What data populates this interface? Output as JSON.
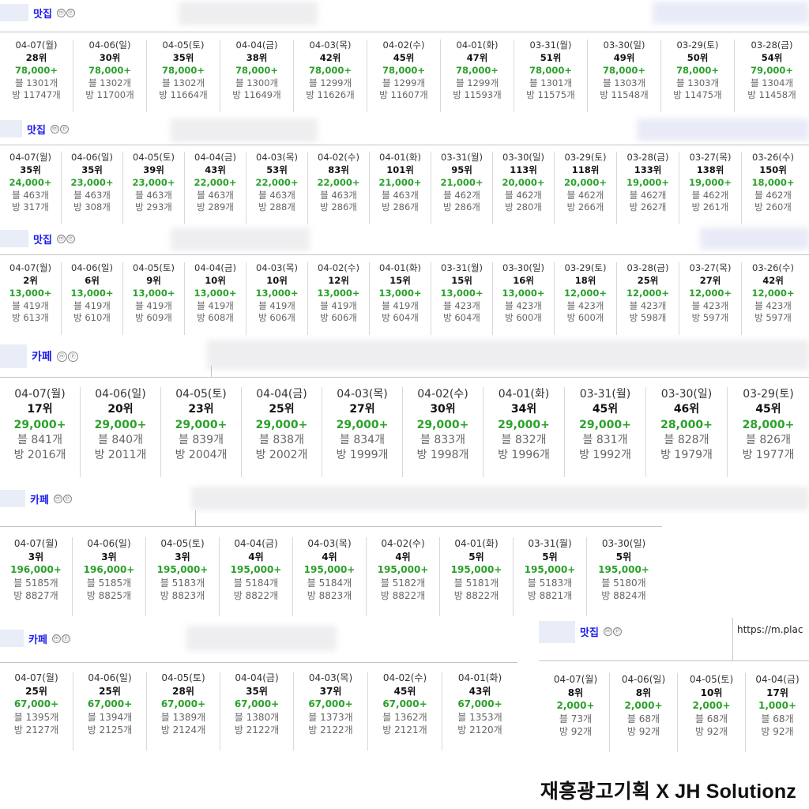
{
  "icon_labels": [
    "ⓜ",
    "ⓟ"
  ],
  "panels": [
    {
      "category": "맛집",
      "cells": [
        {
          "date": "04-07(월)",
          "rank": "28위",
          "price": "78,000+",
          "blog": "블 1301개",
          "bang": "방 11747개"
        },
        {
          "date": "04-06(일)",
          "rank": "30위",
          "price": "78,000+",
          "blog": "블 1302개",
          "bang": "방 11700개"
        },
        {
          "date": "04-05(토)",
          "rank": "35위",
          "price": "78,000+",
          "blog": "블 1302개",
          "bang": "방 11664개"
        },
        {
          "date": "04-04(금)",
          "rank": "38위",
          "price": "78,000+",
          "blog": "블 1300개",
          "bang": "방 11649개"
        },
        {
          "date": "04-03(목)",
          "rank": "42위",
          "price": "78,000+",
          "blog": "블 1299개",
          "bang": "방 11626개"
        },
        {
          "date": "04-02(수)",
          "rank": "45위",
          "price": "78,000+",
          "blog": "블 1299개",
          "bang": "방 11607개"
        },
        {
          "date": "04-01(화)",
          "rank": "47위",
          "price": "78,000+",
          "blog": "블 1299개",
          "bang": "방 11593개"
        },
        {
          "date": "03-31(월)",
          "rank": "51위",
          "price": "78,000+",
          "blog": "블 1301개",
          "bang": "방 11575개"
        },
        {
          "date": "03-30(일)",
          "rank": "49위",
          "price": "78,000+",
          "blog": "블 1303개",
          "bang": "방 11548개"
        },
        {
          "date": "03-29(토)",
          "rank": "50위",
          "price": "78,000+",
          "blog": "블 1303개",
          "bang": "방 11475개"
        },
        {
          "date": "03-28(금)",
          "rank": "54위",
          "price": "79,000+",
          "blog": "블 1304개",
          "bang": "방 11458개"
        }
      ]
    },
    {
      "category": "맛집",
      "cells": [
        {
          "date": "04-07(월)",
          "rank": "35위",
          "price": "24,000+",
          "blog": "블 463개",
          "bang": "방 317개"
        },
        {
          "date": "04-06(일)",
          "rank": "35위",
          "price": "23,000+",
          "blog": "블 463개",
          "bang": "방 308개"
        },
        {
          "date": "04-05(토)",
          "rank": "39위",
          "price": "23,000+",
          "blog": "블 463개",
          "bang": "방 293개"
        },
        {
          "date": "04-04(금)",
          "rank": "43위",
          "price": "22,000+",
          "blog": "블 463개",
          "bang": "방 289개"
        },
        {
          "date": "04-03(목)",
          "rank": "53위",
          "price": "22,000+",
          "blog": "블 463개",
          "bang": "방 288개"
        },
        {
          "date": "04-02(수)",
          "rank": "83위",
          "price": "22,000+",
          "blog": "블 463개",
          "bang": "방 286개"
        },
        {
          "date": "04-01(화)",
          "rank": "101위",
          "price": "21,000+",
          "blog": "블 463개",
          "bang": "방 286개"
        },
        {
          "date": "03-31(월)",
          "rank": "95위",
          "price": "21,000+",
          "blog": "블 462개",
          "bang": "방 286개"
        },
        {
          "date": "03-30(일)",
          "rank": "113위",
          "price": "20,000+",
          "blog": "블 462개",
          "bang": "방 280개"
        },
        {
          "date": "03-29(토)",
          "rank": "118위",
          "price": "20,000+",
          "blog": "블 462개",
          "bang": "방 266개"
        },
        {
          "date": "03-28(금)",
          "rank": "133위",
          "price": "19,000+",
          "blog": "블 462개",
          "bang": "방 262개"
        },
        {
          "date": "03-27(목)",
          "rank": "138위",
          "price": "19,000+",
          "blog": "블 462개",
          "bang": "방 261개"
        },
        {
          "date": "03-26(수)",
          "rank": "150위",
          "price": "18,000+",
          "blog": "블 462개",
          "bang": "방 260개"
        }
      ]
    },
    {
      "category": "맛집",
      "cells": [
        {
          "date": "04-07(월)",
          "rank": "2위",
          "price": "13,000+",
          "blog": "블 419개",
          "bang": "방 613개"
        },
        {
          "date": "04-06(일)",
          "rank": "6위",
          "price": "13,000+",
          "blog": "블 419개",
          "bang": "방 610개"
        },
        {
          "date": "04-05(토)",
          "rank": "9위",
          "price": "13,000+",
          "blog": "블 419개",
          "bang": "방 609개"
        },
        {
          "date": "04-04(금)",
          "rank": "10위",
          "price": "13,000+",
          "blog": "블 419개",
          "bang": "방 608개"
        },
        {
          "date": "04-03(목)",
          "rank": "10위",
          "price": "13,000+",
          "blog": "블 419개",
          "bang": "방 606개"
        },
        {
          "date": "04-02(수)",
          "rank": "12위",
          "price": "13,000+",
          "blog": "블 419개",
          "bang": "방 606개"
        },
        {
          "date": "04-01(화)",
          "rank": "15위",
          "price": "13,000+",
          "blog": "블 419개",
          "bang": "방 604개"
        },
        {
          "date": "03-31(월)",
          "rank": "15위",
          "price": "13,000+",
          "blog": "블 423개",
          "bang": "방 604개"
        },
        {
          "date": "03-30(일)",
          "rank": "16위",
          "price": "13,000+",
          "blog": "블 423개",
          "bang": "방 600개"
        },
        {
          "date": "03-29(토)",
          "rank": "18위",
          "price": "12,000+",
          "blog": "블 423개",
          "bang": "방 600개"
        },
        {
          "date": "03-28(금)",
          "rank": "25위",
          "price": "12,000+",
          "blog": "블 423개",
          "bang": "방 598개"
        },
        {
          "date": "03-27(목)",
          "rank": "27위",
          "price": "12,000+",
          "blog": "블 423개",
          "bang": "방 597개"
        },
        {
          "date": "03-26(수)",
          "rank": "42위",
          "price": "12,000+",
          "blog": "블 423개",
          "bang": "방 597개"
        }
      ]
    },
    {
      "category": "카페",
      "cells": [
        {
          "date": "04-07(월)",
          "rank": "17위",
          "price": "29,000+",
          "blog": "블 841개",
          "bang": "방 2016개"
        },
        {
          "date": "04-06(일)",
          "rank": "20위",
          "price": "29,000+",
          "blog": "블 840개",
          "bang": "방 2011개"
        },
        {
          "date": "04-05(토)",
          "rank": "23위",
          "price": "29,000+",
          "blog": "블 839개",
          "bang": "방 2004개"
        },
        {
          "date": "04-04(금)",
          "rank": "25위",
          "price": "29,000+",
          "blog": "블 838개",
          "bang": "방 2002개"
        },
        {
          "date": "04-03(목)",
          "rank": "27위",
          "price": "29,000+",
          "blog": "블 834개",
          "bang": "방 1999개"
        },
        {
          "date": "04-02(수)",
          "rank": "30위",
          "price": "29,000+",
          "blog": "블 833개",
          "bang": "방 1998개"
        },
        {
          "date": "04-01(화)",
          "rank": "34위",
          "price": "29,000+",
          "blog": "블 832개",
          "bang": "방 1996개"
        },
        {
          "date": "03-31(월)",
          "rank": "45위",
          "price": "29,000+",
          "blog": "블 831개",
          "bang": "방 1992개"
        },
        {
          "date": "03-30(일)",
          "rank": "46위",
          "price": "28,000+",
          "blog": "블 828개",
          "bang": "방 1979개"
        },
        {
          "date": "03-29(토)",
          "rank": "45위",
          "price": "28,000+",
          "blog": "블 826개",
          "bang": "방 1977개"
        }
      ]
    },
    {
      "category": "카페",
      "cells": [
        {
          "date": "04-07(월)",
          "rank": "3위",
          "price": "196,000+",
          "blog": "블 5185개",
          "bang": "방 8827개"
        },
        {
          "date": "04-06(일)",
          "rank": "3위",
          "price": "196,000+",
          "blog": "블 5185개",
          "bang": "방 8825개"
        },
        {
          "date": "04-05(토)",
          "rank": "3위",
          "price": "195,000+",
          "blog": "블 5183개",
          "bang": "방 8823개"
        },
        {
          "date": "04-04(금)",
          "rank": "4위",
          "price": "195,000+",
          "blog": "블 5184개",
          "bang": "방 8822개"
        },
        {
          "date": "04-03(목)",
          "rank": "4위",
          "price": "195,000+",
          "blog": "블 5184개",
          "bang": "방 8823개"
        },
        {
          "date": "04-02(수)",
          "rank": "4위",
          "price": "195,000+",
          "blog": "블 5182개",
          "bang": "방 8822개"
        },
        {
          "date": "04-01(화)",
          "rank": "5위",
          "price": "195,000+",
          "blog": "블 5181개",
          "bang": "방 8822개"
        },
        {
          "date": "03-31(월)",
          "rank": "5위",
          "price": "195,000+",
          "blog": "블 5183개",
          "bang": "방 8821개"
        },
        {
          "date": "03-30(일)",
          "rank": "5위",
          "price": "195,000+",
          "blog": "블 5180개",
          "bang": "방 8824개"
        }
      ]
    },
    {
      "category": "카페",
      "cells": [
        {
          "date": "04-07(월)",
          "rank": "25위",
          "price": "67,000+",
          "blog": "블 1395개",
          "bang": "방 2127개"
        },
        {
          "date": "04-06(일)",
          "rank": "25위",
          "price": "67,000+",
          "blog": "블 1394개",
          "bang": "방 2125개"
        },
        {
          "date": "04-05(토)",
          "rank": "28위",
          "price": "67,000+",
          "blog": "블 1389개",
          "bang": "방 2124개"
        },
        {
          "date": "04-04(금)",
          "rank": "35위",
          "price": "67,000+",
          "blog": "블 1380개",
          "bang": "방 2122개"
        },
        {
          "date": "04-03(목)",
          "rank": "37위",
          "price": "67,000+",
          "blog": "블 1373개",
          "bang": "방 2122개"
        },
        {
          "date": "04-02(수)",
          "rank": "45위",
          "price": "67,000+",
          "blog": "블 1362개",
          "bang": "방 2121개"
        },
        {
          "date": "04-01(화)",
          "rank": "43위",
          "price": "67,000+",
          "blog": "블 1353개",
          "bang": "방 2120개"
        }
      ]
    },
    {
      "category": "맛집",
      "cells": [
        {
          "date": "04-07(월)",
          "rank": "8위",
          "price": "2,000+",
          "blog": "블 73개",
          "bang": "방 92개"
        },
        {
          "date": "04-06(일)",
          "rank": "8위",
          "price": "2,000+",
          "blog": "블 68개",
          "bang": "방 92개"
        },
        {
          "date": "04-05(토)",
          "rank": "10위",
          "price": "2,000+",
          "blog": "블 68개",
          "bang": "방 92개"
        },
        {
          "date": "04-04(금)",
          "rank": "17위",
          "price": "1,000+",
          "blog": "블 68개",
          "bang": "방 92개"
        }
      ]
    }
  ],
  "url_text": "https://m.plac",
  "footer": "재흥광고기획 X JH Solutionz",
  "colors": {
    "category": "#1a1aee",
    "price": "#2aa12a",
    "text": "#222222",
    "sub": "#666666"
  }
}
